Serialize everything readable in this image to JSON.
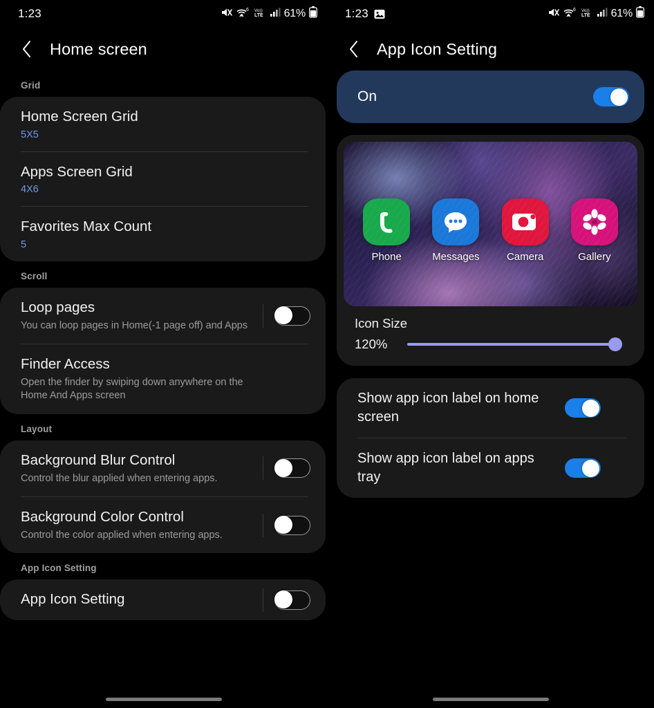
{
  "left": {
    "statusbar": {
      "time": "1:23",
      "battery_text": "61%",
      "icons": [
        "mute-icon",
        "wifi6-icon",
        "volte-icon",
        "signal-bars-icon",
        "battery-icon"
      ]
    },
    "appbar": {
      "title": "Home screen",
      "back_icon": "back-chevron-icon"
    },
    "sections": [
      {
        "header": "Grid",
        "rows": [
          {
            "title": "Home Screen Grid",
            "value": "5X5",
            "sub": "",
            "toggle": null
          },
          {
            "title": "Apps Screen Grid",
            "value": "4X6",
            "sub": "",
            "toggle": null
          },
          {
            "title": "Favorites Max Count",
            "value": "5",
            "sub": "",
            "toggle": null
          }
        ]
      },
      {
        "header": "Scroll",
        "rows": [
          {
            "title": "Loop pages",
            "value": "",
            "sub": "You can loop pages in Home(-1 page off) and Apps",
            "toggle": "off"
          },
          {
            "title": "Finder Access",
            "value": "",
            "sub": "Open the finder by swiping down anywhere on the Home And Apps screen",
            "toggle": null
          }
        ]
      },
      {
        "header": "Layout",
        "rows": [
          {
            "title": "Background Blur Control",
            "value": "",
            "sub": "Control the blur applied when entering apps.",
            "toggle": "off"
          },
          {
            "title": "Background Color Control",
            "value": "",
            "sub": "Control the color applied when entering apps.",
            "toggle": "off"
          }
        ]
      },
      {
        "header": "App Icon Setting",
        "rows": [
          {
            "title": "App Icon Setting",
            "value": "",
            "sub": "",
            "toggle": "off"
          }
        ]
      }
    ]
  },
  "right": {
    "statusbar": {
      "time": "1:23",
      "battery_text": "61%",
      "icons": [
        "screenshot-icon",
        "mute-icon",
        "wifi6-icon",
        "volte-icon",
        "signal-bars-icon",
        "battery-icon"
      ]
    },
    "appbar": {
      "title": "App Icon Setting",
      "back_icon": "back-chevron-icon"
    },
    "master_switch": {
      "label": "On",
      "state": "on",
      "card_color": "#23395c",
      "accent": "#1a7fe8"
    },
    "preview": {
      "apps": [
        {
          "label": "Phone",
          "icon": "phone-icon",
          "color": "#18a94b"
        },
        {
          "label": "Messages",
          "icon": "messages-bubble-icon",
          "color": "#1a78d8"
        },
        {
          "label": "Camera",
          "icon": "camera-icon",
          "color": "#e0153c"
        },
        {
          "label": "Gallery",
          "icon": "gallery-flower-icon",
          "color": "#d6127a"
        }
      ]
    },
    "icon_size": {
      "label": "Icon Size",
      "value": "120%",
      "percent": 100,
      "accent": "#9a9aee"
    },
    "options": [
      {
        "title": "Show app icon label on home screen",
        "toggle": "on"
      },
      {
        "title": "Show app icon label on apps tray",
        "toggle": "on"
      }
    ]
  }
}
